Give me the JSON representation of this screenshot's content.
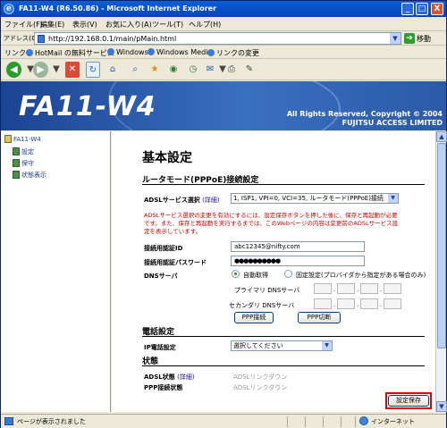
{
  "window": {
    "title": "FA11-W4 (R6.50.86) - Microsoft Internet Explorer",
    "min": "_",
    "max": "□",
    "close": "X",
    "logo_letter": "e"
  },
  "menu": [
    "ファイル(F)",
    "編集(E)",
    "表示(V)",
    "お気に入り(A)",
    "ツール(T)",
    "ヘルプ(H)"
  ],
  "address": {
    "label": "アドレス(D)",
    "url": "http://192.168.0.1/main/pMain.html",
    "go_label": "移動"
  },
  "links": {
    "label": "リンク",
    "items": [
      "HotMail の無料サービス",
      "Windows",
      "Windows Media",
      "リンクの変更"
    ]
  },
  "banner": {
    "logo": "FA11-W4",
    "copyright": "All Rights Reserved, Copyright © 2004",
    "company": "FUJITSU ACCESS LIMITED"
  },
  "tree": {
    "root": "FA11-W4",
    "items": [
      "設定",
      "保守",
      "状態表示"
    ]
  },
  "page": {
    "title": "基本設定",
    "router_section": "ルータモード(PPPoE)接続設定",
    "adsl_label": "ADSLサービス選択",
    "adsl_detail": "(詳細)",
    "adsl_value": "1, ISP1, VPI=0, VCI=35, ルータモード(PPPoE)接続",
    "note": "ADSLサービス選択の変更を有効にするには、設定保存ボタンを押した後に、保存と再起動が必要です。また、保存と再起動を実行するまでは、このWebページの内容は変更前のADSLサービス設定を表示しています。",
    "auth_id_label": "接続用認証ID",
    "auth_id_value": "abc12345@nifty.com",
    "auth_pw_label": "接続用認証パスワード",
    "auth_pw_value": "●●●●●●●●●●",
    "dns_label": "DNSサーバ",
    "dns_auto": "自動取得",
    "dns_fixed": "固定設定(プロバイダから指定がある場合のみ)",
    "dns_primary": "プライマリ DNSサーバ",
    "dns_secondary": "セカンダリ DNSサーバ",
    "ppp_connect": "PPP接続",
    "ppp_disconnect": "PPP切断",
    "phone_section": "電話設定",
    "ip_phone_label": "IP電話設定",
    "ip_phone_value": "選択してください",
    "status_section": "状態",
    "adsl_status_label": "ADSL状態",
    "adsl_status_detail": "(詳細)",
    "adsl_status_value": "ADSLリンクダウン",
    "ppp_status_label": "PPP接続状態",
    "ppp_status_value": "ADSLリンクダウン",
    "save_button": "設定保存"
  },
  "status": {
    "text": "ページが表示されました",
    "zone": "インターネット"
  },
  "toolbar_icons": [
    "back-icon",
    "forward-icon",
    "stop-icon",
    "refresh-icon",
    "home-icon",
    "search-icon",
    "favorites-icon",
    "media-icon",
    "history-icon",
    "mail-icon",
    "print-icon",
    "edit-icon"
  ],
  "colors": {
    "title_bar": "#0a5fd8",
    "banner": "#1b4493",
    "note_red": "#d00000",
    "save_highlight": "#e10000"
  }
}
